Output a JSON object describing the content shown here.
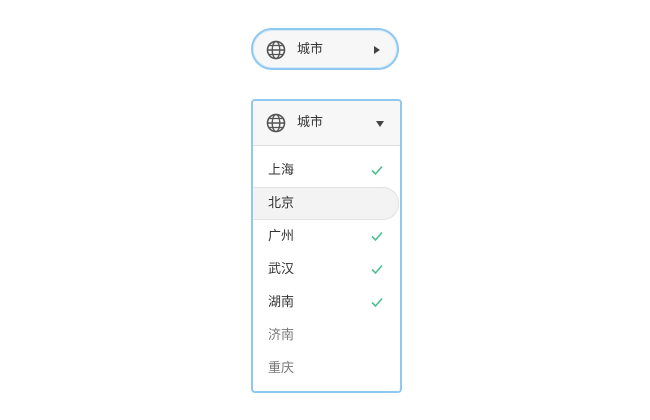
{
  "collapsed_dropdown": {
    "label": "城市",
    "icon": "globe-icon",
    "indicator": "caret-right-icon"
  },
  "expanded_dropdown": {
    "label": "城市",
    "icon": "globe-icon",
    "indicator": "caret-down-icon",
    "options": [
      {
        "label": "上海",
        "checked": true
      },
      {
        "label": "北京",
        "checked": false,
        "hovered": true
      },
      {
        "label": "广州",
        "checked": true
      },
      {
        "label": "武汉",
        "checked": true
      },
      {
        "label": "湖南",
        "checked": true
      },
      {
        "label": "济南",
        "checked": false
      },
      {
        "label": "重庆",
        "checked": false
      }
    ]
  },
  "colors": {
    "focus_border": "#8fc8f0",
    "check": "#4cbf8f",
    "header_bg": "#f7f7f7"
  }
}
